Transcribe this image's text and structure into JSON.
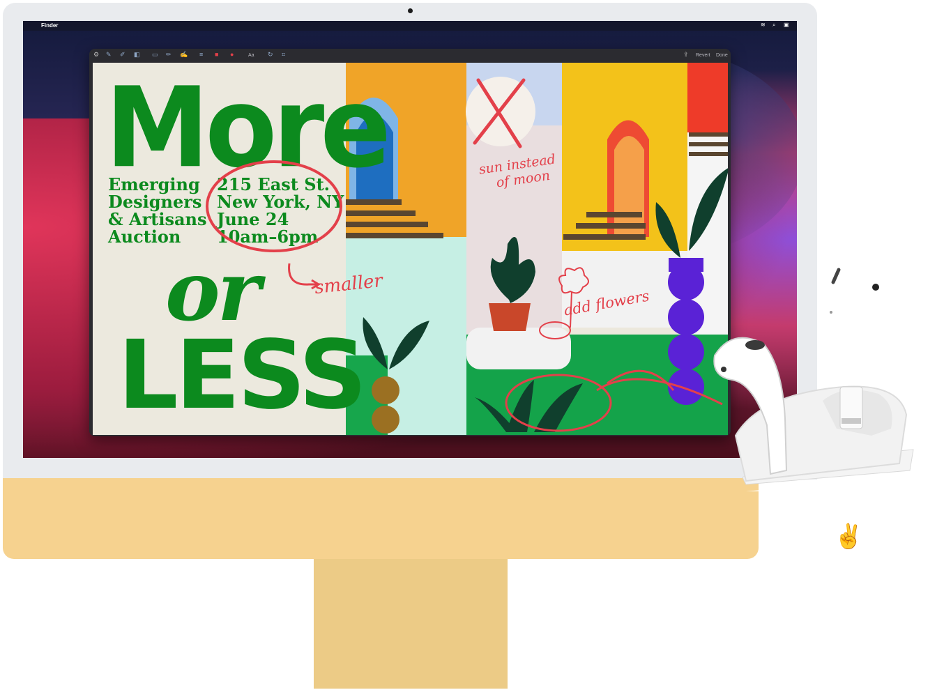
{
  "menubar": {
    "app_name": "Finder"
  },
  "toolbar": {
    "revert_label": "Revert",
    "done_label": "Done",
    "font_label": "Aa"
  },
  "poster": {
    "headline_top": "More",
    "headline_mid": "or",
    "headline_bottom": "LESS",
    "event_lines": [
      "Emerging",
      "Designers",
      "& Artisans",
      "Auction"
    ],
    "details_lines": [
      "215 East St.",
      "New York, NY",
      "June 24",
      "10am–6pm"
    ]
  },
  "annotations": {
    "smaller": "smaller",
    "sun_note_line1": "sun instead",
    "sun_note_line2": "of moon",
    "flowers": "add flowers"
  },
  "colors": {
    "poster_green": "#0c8a1e",
    "markup_red": "#e3404a",
    "imac_yellow": "#f6d28f"
  }
}
